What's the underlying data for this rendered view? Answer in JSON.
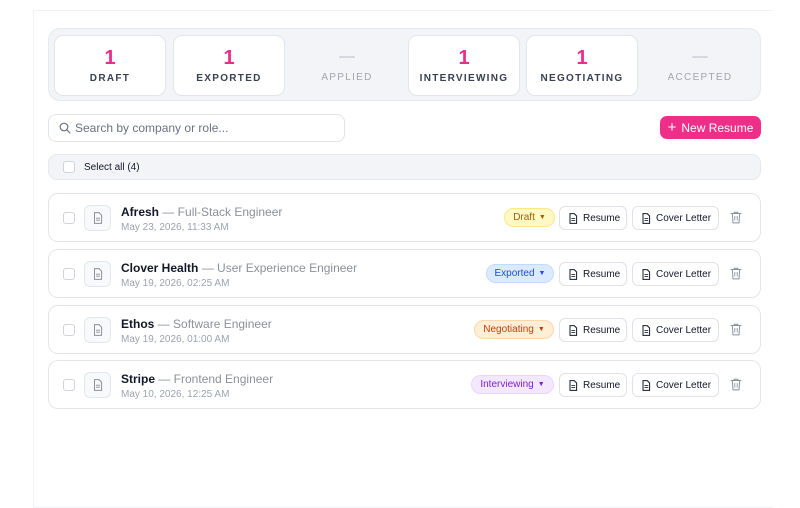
{
  "stats": [
    {
      "count": "1",
      "label": "DRAFT",
      "active": true
    },
    {
      "count": "1",
      "label": "EXPORTED",
      "active": true
    },
    {
      "count": "",
      "label": "APPLIED",
      "active": false
    },
    {
      "count": "1",
      "label": "INTERVIEWING",
      "active": true
    },
    {
      "count": "1",
      "label": "NEGOTIATING",
      "active": true
    },
    {
      "count": "",
      "label": "ACCEPTED",
      "active": false
    }
  ],
  "search": {
    "placeholder": "Search by company or role...",
    "value": ""
  },
  "new_button": {
    "label": "New Resume"
  },
  "select_all": {
    "label": "Select all (4)"
  },
  "colors": {
    "accent": "#ee2f87"
  },
  "rows": [
    {
      "company": "Afresh",
      "role": " — Full-Stack Engineer",
      "date": "May 23, 2026, 11:33 AM",
      "status": "Draft",
      "status_key": "draft",
      "resume_label": "Resume",
      "cover_label": "Cover Letter"
    },
    {
      "company": "Clover Health",
      "role": " — User Experience Engineer",
      "date": "May 19, 2026, 02:25 AM",
      "status": "Exported",
      "status_key": "exported",
      "resume_label": "Resume",
      "cover_label": "Cover Letter"
    },
    {
      "company": "Ethos",
      "role": " — Software Engineer",
      "date": "May 19, 2026, 01:00 AM",
      "status": "Negotiating",
      "status_key": "negotiating",
      "resume_label": "Resume",
      "cover_label": "Cover Letter"
    },
    {
      "company": "Stripe",
      "role": " — Frontend Engineer",
      "date": "May 10, 2026, 12:25 AM",
      "status": "Interviewing",
      "status_key": "interviewing",
      "resume_label": "Resume",
      "cover_label": "Cover Letter"
    }
  ],
  "status_colors": {
    "draft": {
      "bg": "#fef9c3",
      "border": "#fde68a",
      "text": "#a16207"
    },
    "exported": {
      "bg": "#dbeafe",
      "border": "#bfdbfe",
      "text": "#1d4ed8"
    },
    "negotiating": {
      "bg": "#ffedd5",
      "border": "#fed7aa",
      "text": "#c2410c"
    },
    "interviewing": {
      "bg": "#f3e8ff",
      "border": "#e9d5ff",
      "text": "#7e22ce"
    }
  }
}
